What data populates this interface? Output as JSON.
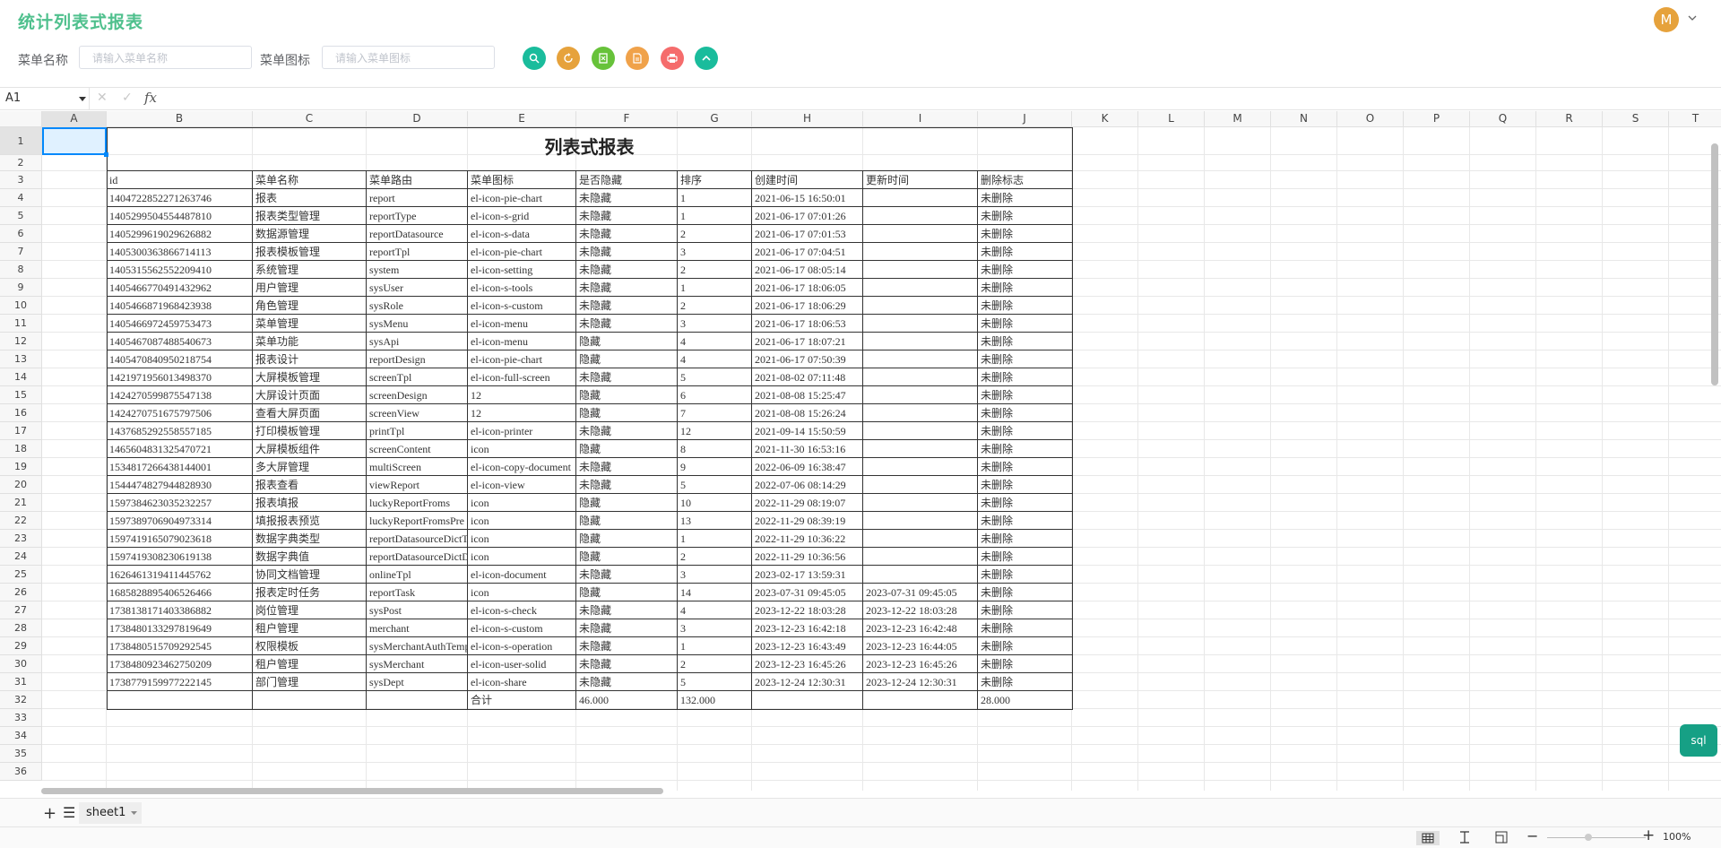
{
  "app": {
    "title": "统计列表式报表",
    "avatar_letter": "M"
  },
  "search": {
    "name_label": "菜单名称",
    "name_placeholder": "请输入菜单名称",
    "icon_label": "菜单图标",
    "icon_placeholder": "请输入菜单图标"
  },
  "toolbar": {
    "buttons": [
      {
        "name": "search-button",
        "icon": "search-icon",
        "color": "#1abc9c"
      },
      {
        "name": "reset-button",
        "icon": "refresh-icon",
        "color": "#e6a23c"
      },
      {
        "name": "export-excel-button",
        "icon": "excel-icon",
        "color": "#67c23a"
      },
      {
        "name": "export-pdf-button",
        "icon": "pdf-icon",
        "color": "#f0a24a"
      },
      {
        "name": "print-button",
        "icon": "printer-icon",
        "color": "#f56c6c"
      },
      {
        "name": "collapse-button",
        "icon": "chevron-up-icon",
        "color": "#1abc9c"
      }
    ]
  },
  "formula": {
    "cell_ref": "A1",
    "fx": "fx"
  },
  "sheet": {
    "columns": [
      "A",
      "B",
      "C",
      "D",
      "E",
      "F",
      "G",
      "H",
      "I",
      "J",
      "K",
      "L",
      "M",
      "N",
      "O",
      "P",
      "Q",
      "R",
      "S",
      "T"
    ],
    "rows": [
      "1",
      "2",
      "3",
      "4",
      "5",
      "6",
      "7",
      "8",
      "9",
      "10",
      "11",
      "12",
      "13",
      "14",
      "15",
      "16",
      "17",
      "18",
      "19",
      "20",
      "21",
      "22",
      "23",
      "24",
      "25",
      "26",
      "27",
      "28",
      "29",
      "30",
      "31",
      "32",
      "33",
      "34",
      "35",
      "36"
    ]
  },
  "report": {
    "title": "列表式报表",
    "headers": [
      "id",
      "菜单名称",
      "菜单路由",
      "菜单图标",
      "是否隐藏",
      "排序",
      "创建时间",
      "更新时间",
      "删除标志"
    ],
    "rows": [
      [
        "1404722852271263746",
        "报表",
        "report",
        "el-icon-pie-chart",
        "未隐藏",
        "1",
        "2021-06-15 16:50:01",
        "",
        "未删除"
      ],
      [
        "1405299504554487810",
        "报表类型管理",
        "reportType",
        "el-icon-s-grid",
        "未隐藏",
        "1",
        "2021-06-17 07:01:26",
        "",
        "未删除"
      ],
      [
        "1405299619029626882",
        "数据源管理",
        "reportDatasource",
        "el-icon-s-data",
        "未隐藏",
        "2",
        "2021-06-17 07:01:53",
        "",
        "未删除"
      ],
      [
        "1405300363866714113",
        "报表模板管理",
        "reportTpl",
        "el-icon-pie-chart",
        "未隐藏",
        "3",
        "2021-06-17 07:04:51",
        "",
        "未删除"
      ],
      [
        "1405315562552209410",
        "系统管理",
        "system",
        "el-icon-setting",
        "未隐藏",
        "2",
        "2021-06-17 08:05:14",
        "",
        "未删除"
      ],
      [
        "1405466770491432962",
        "用户管理",
        "sysUser",
        "el-icon-s-tools",
        "未隐藏",
        "1",
        "2021-06-17 18:06:05",
        "",
        "未删除"
      ],
      [
        "1405466871968423938",
        "角色管理",
        "sysRole",
        "el-icon-s-custom",
        "未隐藏",
        "2",
        "2021-06-17 18:06:29",
        "",
        "未删除"
      ],
      [
        "1405466972459753473",
        "菜单管理",
        "sysMenu",
        "el-icon-menu",
        "未隐藏",
        "3",
        "2021-06-17 18:06:53",
        "",
        "未删除"
      ],
      [
        "1405467087488540673",
        "菜单功能",
        "sysApi",
        "el-icon-menu",
        "隐藏",
        "4",
        "2021-06-17 18:07:21",
        "",
        "未删除"
      ],
      [
        "1405470840950218754",
        "报表设计",
        "reportDesign",
        "el-icon-pie-chart",
        "隐藏",
        "4",
        "2021-06-17 07:50:39",
        "",
        "未删除"
      ],
      [
        "1421971956013498370",
        "大屏模板管理",
        "screenTpl",
        "el-icon-full-screen",
        "未隐藏",
        "5",
        "2021-08-02 07:11:48",
        "",
        "未删除"
      ],
      [
        "1424270599875547138",
        "大屏设计页面",
        "screenDesign",
        "12",
        "隐藏",
        "6",
        "2021-08-08 15:25:47",
        "",
        "未删除"
      ],
      [
        "1424270751675797506",
        "查看大屏页面",
        "screenView",
        "12",
        "隐藏",
        "7",
        "2021-08-08 15:26:24",
        "",
        "未删除"
      ],
      [
        "1437685292558557185",
        "打印模板管理",
        "printTpl",
        "el-icon-printer",
        "未隐藏",
        "12",
        "2021-09-14 15:50:59",
        "",
        "未删除"
      ],
      [
        "1465604831325470721",
        "大屏模板组件",
        "screenContent",
        "icon",
        "隐藏",
        "8",
        "2021-11-30 16:53:16",
        "",
        "未删除"
      ],
      [
        "1534817266438144001",
        "多大屏管理",
        "multiScreen",
        "el-icon-copy-document",
        "未隐藏",
        "9",
        "2022-06-09 16:38:47",
        "",
        "未删除"
      ],
      [
        "1544474827944828930",
        "报表查看",
        "viewReport",
        "el-icon-view",
        "未隐藏",
        "5",
        "2022-07-06 08:14:29",
        "",
        "未删除"
      ],
      [
        "1597384623035232257",
        "报表填报",
        "luckyReportFroms",
        "icon",
        "隐藏",
        "10",
        "2022-11-29 08:19:07",
        "",
        "未删除"
      ],
      [
        "1597389706904973314",
        "填报报表预览",
        "luckyReportFromsPre",
        "icon",
        "隐藏",
        "13",
        "2022-11-29 08:39:19",
        "",
        "未删除"
      ],
      [
        "1597419165079023618",
        "数据字典类型",
        "reportDatasourceDictType",
        "icon",
        "隐藏",
        "1",
        "2022-11-29 10:36:22",
        "",
        "未删除"
      ],
      [
        "1597419308230619138",
        "数据字典值",
        "reportDatasourceDictData",
        "icon",
        "隐藏",
        "2",
        "2022-11-29 10:36:56",
        "",
        "未删除"
      ],
      [
        "1626461319411445762",
        "协同文档管理",
        "onlineTpl",
        "el-icon-document",
        "未隐藏",
        "3",
        "2023-02-17 13:59:31",
        "",
        "未删除"
      ],
      [
        "1685828895406526466",
        "报表定时任务",
        "reportTask",
        "icon",
        "隐藏",
        "14",
        "2023-07-31 09:45:05",
        "2023-07-31 09:45:05",
        "未删除"
      ],
      [
        "1738138171403386882",
        "岗位管理",
        "sysPost",
        "el-icon-s-check",
        "未隐藏",
        "4",
        "2023-12-22 18:03:28",
        "2023-12-22 18:03:28",
        "未删除"
      ],
      [
        "1738480133297819649",
        "租户管理",
        "merchant",
        "el-icon-s-custom",
        "未隐藏",
        "3",
        "2023-12-23 16:42:18",
        "2023-12-23 16:42:48",
        "未删除"
      ],
      [
        "1738480515709292545",
        "权限模板",
        "sysMerchantAuthTemplate",
        "el-icon-s-operation",
        "未隐藏",
        "1",
        "2023-12-23 16:43:49",
        "2023-12-23 16:44:05",
        "未删除"
      ],
      [
        "1738480923462750209",
        "租户管理",
        "sysMerchant",
        "el-icon-user-solid",
        "未隐藏",
        "2",
        "2023-12-23 16:45:26",
        "2023-12-23 16:45:26",
        "未删除"
      ],
      [
        "1738779159977222145",
        "部门管理",
        "sysDept",
        "el-icon-share",
        "未隐藏",
        "5",
        "2023-12-24 12:30:31",
        "2023-12-24 12:30:31",
        "未删除"
      ]
    ],
    "total": [
      "",
      "",
      "",
      "合计",
      "46.000",
      "132.000",
      "",
      "",
      "28.000"
    ]
  },
  "sheetbar": {
    "tab": "sheet1"
  },
  "status": {
    "zoom": "100%"
  },
  "sql_button": "sql"
}
